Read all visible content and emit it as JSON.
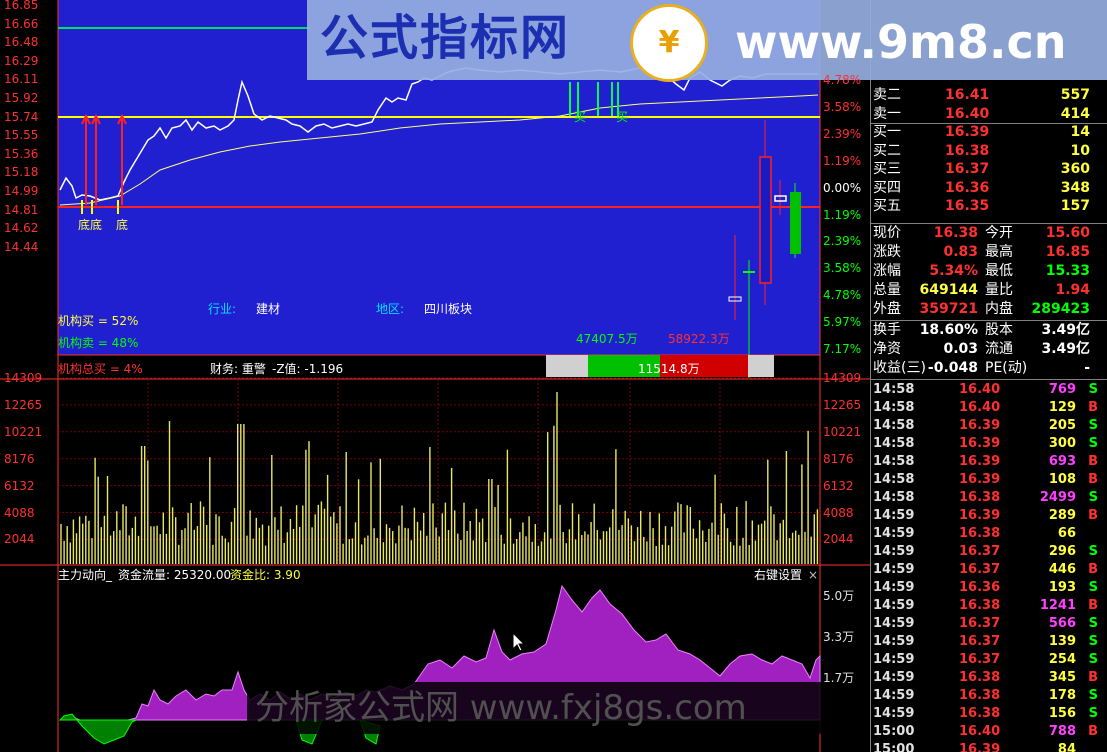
{
  "price_axis": [
    "16.85",
    "16.66",
    "16.48",
    "16.29",
    "16.11",
    "15.92",
    "15.74",
    "15.55",
    "15.36",
    "15.18",
    "14.99",
    "14.81",
    "14.62",
    "14.44"
  ],
  "pct_axis": [
    "4.78%",
    "3.58%",
    "2.39%",
    "1.19%",
    "0.00%",
    "1.19%",
    "2.39%",
    "3.58%",
    "4.78%",
    "5.97%",
    "7.17%"
  ],
  "vol_axis": [
    "14309",
    "12265",
    "10221",
    "8176",
    "6132",
    "4088",
    "2044"
  ],
  "flow_axis": [
    "5.0万",
    "3.3万",
    "1.7万"
  ],
  "chart_labels": {
    "signal_low_1": "底底",
    "signal_low_2": "底",
    "signal_buy": "买",
    "industry_key": "行业:",
    "industry_val": "建材",
    "region_key": "地区:",
    "region_val": "四川板块",
    "inst_buy": "机构买 = 52%",
    "inst_sell": "机构卖 = 48%",
    "inst_total": "机构总买 = 4%",
    "finance": "财务: 重警",
    "zscore": "-Z值: -1.196",
    "bar_left": "47407.5万",
    "bar_right": "58922.3万",
    "bar_mid": "11514.8万"
  },
  "indicator": {
    "name": "主力动向_",
    "flow_label": "资金流量: 25320.00",
    "ratio_label": "资金比: 3.90",
    "settings": "右键设置",
    "close": "×"
  },
  "watermark": {
    "title": "公式指标网",
    "url": "www.9m8.cn",
    "logo": "¥",
    "bottom": "分析家公式网 www.fxj8gs.com"
  },
  "order_book": [
    {
      "side": "卖二",
      "price": "16.41",
      "vol": "557"
    },
    {
      "side": "卖一",
      "price": "16.40",
      "vol": "414"
    },
    {
      "side": "买一",
      "price": "16.39",
      "vol": "14"
    },
    {
      "side": "买二",
      "price": "16.38",
      "vol": "10"
    },
    {
      "side": "买三",
      "price": "16.37",
      "vol": "360"
    },
    {
      "side": "买四",
      "price": "16.36",
      "vol": "348"
    },
    {
      "side": "买五",
      "price": "16.35",
      "vol": "157"
    }
  ],
  "stats": [
    {
      "k1": "现价",
      "v1": "16.38",
      "k2": "今开",
      "v2": "15.60",
      "c1": "red",
      "c2": "red"
    },
    {
      "k1": "涨跌",
      "v1": "0.83",
      "k2": "最高",
      "v2": "16.85",
      "c1": "red",
      "c2": "red"
    },
    {
      "k1": "涨幅",
      "v1": "5.34%",
      "k2": "最低",
      "v2": "15.33",
      "c1": "red",
      "c2": "green"
    },
    {
      "k1": "总量",
      "v1": "649144",
      "k2": "量比",
      "v2": "1.94",
      "c1": "yellow",
      "c2": "red"
    },
    {
      "k1": "外盘",
      "v1": "359721",
      "k2": "内盘",
      "v2": "289423",
      "c1": "red",
      "c2": "green"
    }
  ],
  "stats2": [
    {
      "k1": "换手",
      "v1": "18.60%",
      "k2": "股本",
      "v2": "3.49亿"
    },
    {
      "k1": "净资",
      "v1": "0.03",
      "k2": "流通",
      "v2": "3.49亿"
    },
    {
      "k1": "收益(三)",
      "v1": "-0.048",
      "k2": "PE(动)",
      "v2": "-"
    }
  ],
  "ticks": [
    {
      "t": "14:58",
      "p": "16.40",
      "v": "769",
      "s": "S",
      "pc": "red",
      "vc": "magenta"
    },
    {
      "t": "14:58",
      "p": "16.40",
      "v": "129",
      "s": "B",
      "pc": "red",
      "vc": "yellow"
    },
    {
      "t": "14:58",
      "p": "16.39",
      "v": "205",
      "s": "S",
      "pc": "red",
      "vc": "yellow"
    },
    {
      "t": "14:58",
      "p": "16.39",
      "v": "300",
      "s": "S",
      "pc": "red",
      "vc": "yellow"
    },
    {
      "t": "14:58",
      "p": "16.39",
      "v": "693",
      "s": "B",
      "pc": "red",
      "vc": "magenta"
    },
    {
      "t": "14:58",
      "p": "16.39",
      "v": "108",
      "s": "B",
      "pc": "red",
      "vc": "yellow"
    },
    {
      "t": "14:58",
      "p": "16.38",
      "v": "2499",
      "s": "S",
      "pc": "red",
      "vc": "magenta"
    },
    {
      "t": "14:59",
      "p": "16.39",
      "v": "289",
      "s": "B",
      "pc": "red",
      "vc": "yellow"
    },
    {
      "t": "14:59",
      "p": "16.38",
      "v": "66",
      "s": "",
      "pc": "red",
      "vc": "yellow"
    },
    {
      "t": "14:59",
      "p": "16.37",
      "v": "296",
      "s": "S",
      "pc": "red",
      "vc": "yellow"
    },
    {
      "t": "14:59",
      "p": "16.37",
      "v": "446",
      "s": "B",
      "pc": "red",
      "vc": "yellow"
    },
    {
      "t": "14:59",
      "p": "16.36",
      "v": "193",
      "s": "S",
      "pc": "red",
      "vc": "yellow"
    },
    {
      "t": "14:59",
      "p": "16.38",
      "v": "1241",
      "s": "B",
      "pc": "red",
      "vc": "magenta"
    },
    {
      "t": "14:59",
      "p": "16.37",
      "v": "566",
      "s": "S",
      "pc": "red",
      "vc": "magenta"
    },
    {
      "t": "14:59",
      "p": "16.37",
      "v": "139",
      "s": "S",
      "pc": "red",
      "vc": "yellow"
    },
    {
      "t": "14:59",
      "p": "16.37",
      "v": "254",
      "s": "S",
      "pc": "red",
      "vc": "yellow"
    },
    {
      "t": "14:59",
      "p": "16.38",
      "v": "345",
      "s": "B",
      "pc": "red",
      "vc": "yellow"
    },
    {
      "t": "14:59",
      "p": "16.38",
      "v": "178",
      "s": "S",
      "pc": "red",
      "vc": "yellow"
    },
    {
      "t": "14:59",
      "p": "16.38",
      "v": "156",
      "s": "S",
      "pc": "red",
      "vc": "yellow"
    },
    {
      "t": "15:00",
      "p": "16.40",
      "v": "788",
      "s": "B",
      "pc": "red",
      "vc": "magenta"
    },
    {
      "t": "15:00",
      "p": "16.39",
      "v": "84",
      "s": "",
      "pc": "red",
      "vc": "yellow"
    }
  ],
  "colors": {
    "up": "#ff3030",
    "down": "#00ff00",
    "price_line": "#ffffff",
    "avg_line": "#ffff80",
    "chart_bg": "#2020d0",
    "flow_fill": "#a020c0"
  }
}
